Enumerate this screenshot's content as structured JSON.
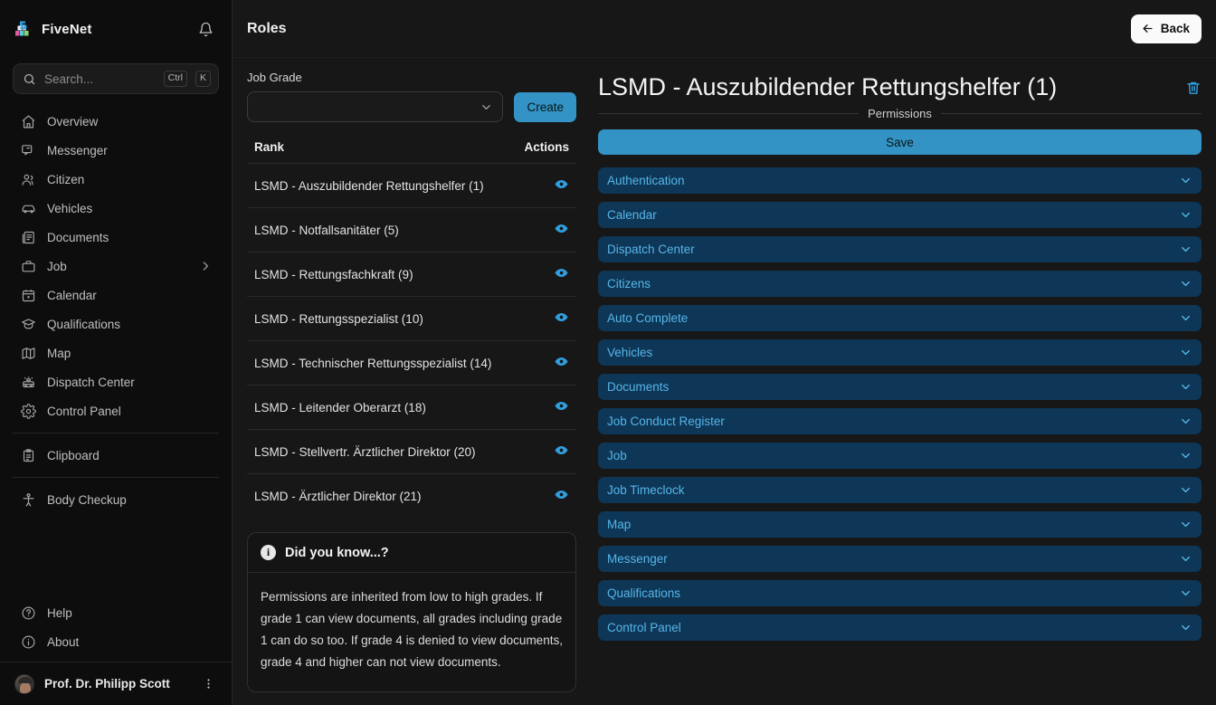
{
  "brand": {
    "name": "FiveNet",
    "logo_icon": "fivenet-logo-icon",
    "bell_icon": "bell-icon"
  },
  "search": {
    "placeholder": "Search...",
    "icon": "search-icon",
    "kbd_mod": "Ctrl",
    "kbd_key": "K"
  },
  "sidebar": {
    "items": [
      {
        "label": "Overview",
        "icon": "home-icon"
      },
      {
        "label": "Messenger",
        "icon": "chat-icon"
      },
      {
        "label": "Citizen",
        "icon": "users-icon"
      },
      {
        "label": "Vehicles",
        "icon": "car-icon"
      },
      {
        "label": "Documents",
        "icon": "documents-icon"
      },
      {
        "label": "Job",
        "icon": "briefcase-icon",
        "expandable": true
      },
      {
        "label": "Calendar",
        "icon": "calendar-icon"
      },
      {
        "label": "Qualifications",
        "icon": "graduation-cap-icon"
      },
      {
        "label": "Map",
        "icon": "map-icon"
      },
      {
        "label": "Dispatch Center",
        "icon": "dispatch-icon"
      },
      {
        "label": "Control Panel",
        "icon": "gear-icon"
      }
    ],
    "group_2": [
      {
        "label": "Clipboard",
        "icon": "clipboard-icon"
      }
    ],
    "group_3": [
      {
        "label": "Body Checkup",
        "icon": "body-icon"
      }
    ],
    "bottom": [
      {
        "label": "Help",
        "icon": "question-circle-icon"
      },
      {
        "label": "About",
        "icon": "info-circle-icon"
      }
    ],
    "user": {
      "name": "Prof. Dr. Philipp Scott",
      "menu_icon": "kebab-menu-icon",
      "avatar": "avatar"
    }
  },
  "topbar": {
    "title": "Roles",
    "back_label": "Back",
    "back_icon": "arrow-left-icon"
  },
  "grades": {
    "field_label": "Job Grade",
    "select_value": "",
    "select_icon": "chevron-down-icon",
    "create_label": "Create",
    "columns": {
      "rank": "Rank",
      "actions": "Actions"
    },
    "rows": [
      {
        "rank": "LSMD - Auszubildender Rettungshelfer (1)",
        "action_icon": "eye-icon"
      },
      {
        "rank": "LSMD - Notfallsanitäter (5)",
        "action_icon": "eye-icon"
      },
      {
        "rank": "LSMD - Rettungsfachkraft (9)",
        "action_icon": "eye-icon"
      },
      {
        "rank": "LSMD - Rettungsspezialist (10)",
        "action_icon": "eye-icon"
      },
      {
        "rank": "LSMD - Technischer Rettungsspezialist (14)",
        "action_icon": "eye-icon"
      },
      {
        "rank": "LSMD - Leitender Oberarzt (18)",
        "action_icon": "eye-icon"
      },
      {
        "rank": "LSMD - Stellvertr. Ärztlicher Direktor (20)",
        "action_icon": "eye-icon"
      },
      {
        "rank": "LSMD - Ärztlicher Direktor (21)",
        "action_icon": "eye-icon"
      }
    ]
  },
  "info_card": {
    "icon": "info-icon",
    "title": "Did you know...?",
    "body": "Permissions are inherited from low to high grades. If grade 1 can view documents, all grades including grade 1 can do so too. If grade 4 is denied to view documents, grade 4 and higher can not view documents."
  },
  "role_panel": {
    "title": "LSMD - Auszubildender Rettungshelfer (1)",
    "delete_icon": "trash-icon",
    "divider_label": "Permissions",
    "save_label": "Save",
    "permissions": [
      {
        "label": "Authentication",
        "chevron": "chevron-down-icon"
      },
      {
        "label": "Calendar",
        "chevron": "chevron-down-icon"
      },
      {
        "label": "Dispatch Center",
        "chevron": "chevron-down-icon"
      },
      {
        "label": "Citizens",
        "chevron": "chevron-down-icon"
      },
      {
        "label": "Auto Complete",
        "chevron": "chevron-down-icon"
      },
      {
        "label": "Vehicles",
        "chevron": "chevron-down-icon"
      },
      {
        "label": "Documents",
        "chevron": "chevron-down-icon"
      },
      {
        "label": "Job Conduct Register",
        "chevron": "chevron-down-icon"
      },
      {
        "label": "Job",
        "chevron": "chevron-down-icon"
      },
      {
        "label": "Job Timeclock",
        "chevron": "chevron-down-icon"
      },
      {
        "label": "Map",
        "chevron": "chevron-down-icon"
      },
      {
        "label": "Messenger",
        "chevron": "chevron-down-icon"
      },
      {
        "label": "Qualifications",
        "chevron": "chevron-down-icon"
      },
      {
        "label": "Control Panel",
        "chevron": "chevron-down-icon"
      }
    ]
  },
  "colors": {
    "accent_blue": "#3293c4",
    "link_blue": "#56b6ea",
    "perm_bg": "#0e3656",
    "sidebar_bg": "#0d0d0d",
    "main_bg": "#171717"
  }
}
